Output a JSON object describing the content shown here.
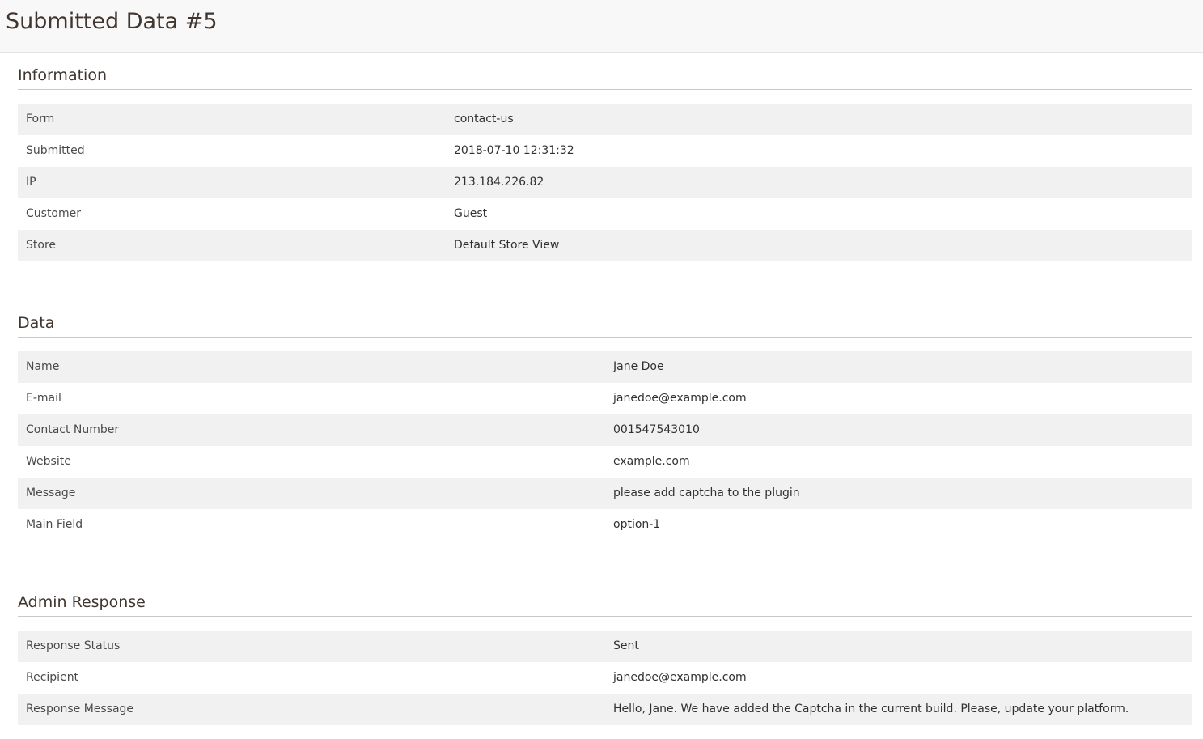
{
  "header": {
    "title": "Submitted Data #5"
  },
  "information": {
    "title": "Information",
    "rows": [
      {
        "label": "Form",
        "value": "contact-us"
      },
      {
        "label": "Submitted",
        "value": "2018-07-10 12:31:32"
      },
      {
        "label": "IP",
        "value": "213.184.226.82"
      },
      {
        "label": "Customer",
        "value": "Guest"
      },
      {
        "label": "Store",
        "value": "Default Store View"
      }
    ]
  },
  "data": {
    "title": "Data",
    "rows": [
      {
        "label": "Name",
        "value": "Jane Doe"
      },
      {
        "label": "E-mail",
        "value": "janedoe@example.com"
      },
      {
        "label": "Contact Number",
        "value": "001547543010"
      },
      {
        "label": "Website",
        "value": "example.com"
      },
      {
        "label": "Message",
        "value": "please add captcha to the plugin"
      },
      {
        "label": "Main Field",
        "value": "option-1"
      }
    ]
  },
  "admin_response": {
    "title": "Admin Response",
    "rows": [
      {
        "label": "Response Status",
        "value": "Sent"
      },
      {
        "label": "Recipient",
        "value": "janedoe@example.com"
      },
      {
        "label": "Response Message",
        "value": "Hello, Jane. We have added the Captcha in the current build. Please, update your platform."
      }
    ]
  },
  "colors": {
    "header_bg": "#f8f8f8",
    "row_stripe": "#f1f1f1",
    "title_text": "#41362f"
  }
}
